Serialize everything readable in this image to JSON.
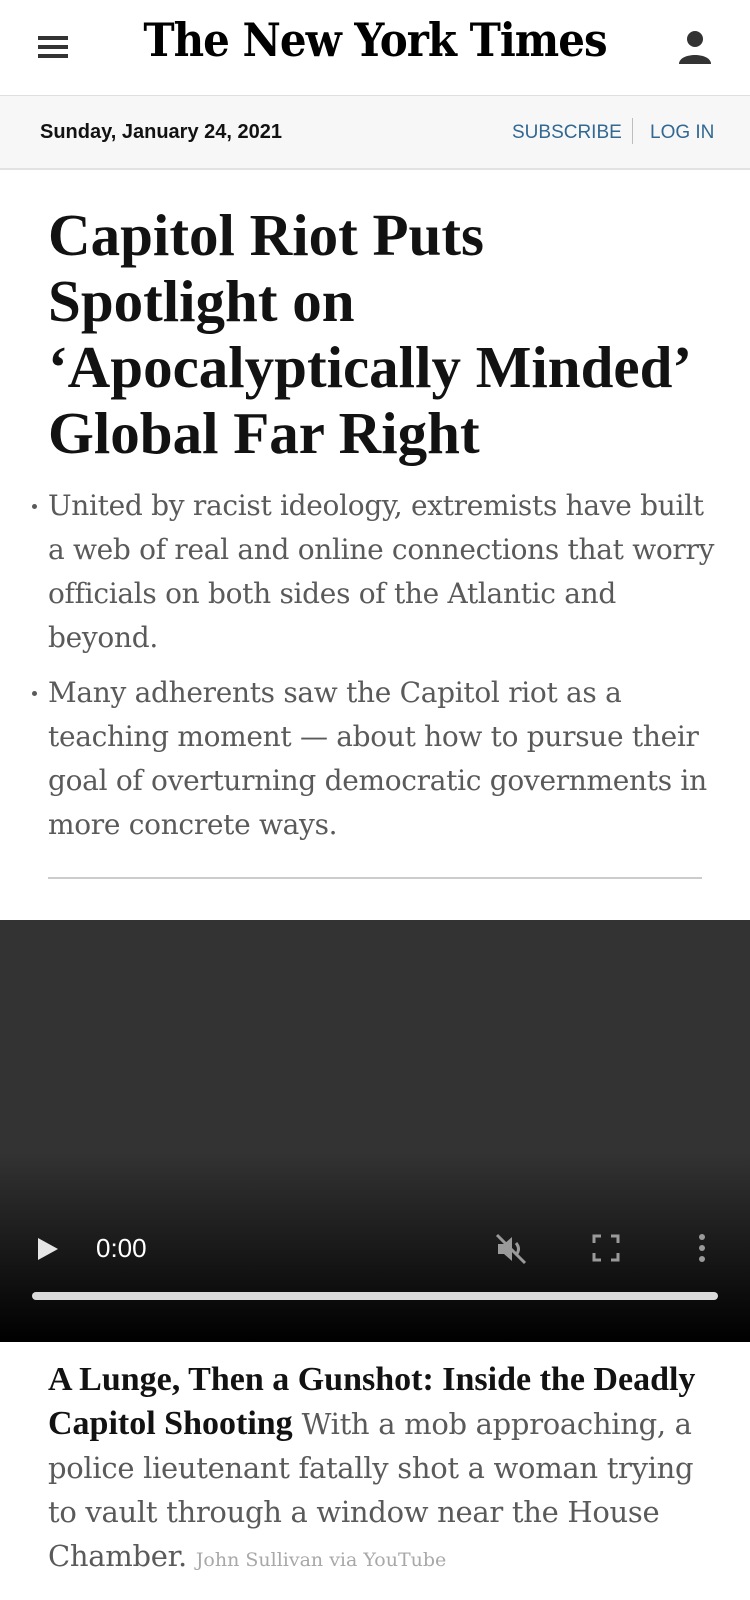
{
  "header": {
    "logo_text": "The New York Times"
  },
  "datebar": {
    "date": "Sunday, January 24, 2021",
    "subscribe_label": "SUBSCRIBE",
    "login_label": "LOG IN"
  },
  "article": {
    "headline": "Capitol Riot Puts Spotlight on ‘Apocalyptically Minded’ Global Far Right",
    "summary": [
      "United by racist ideology, extremists have built a web of real and online connections that worry officials on both sides of the Atlantic and beyond.",
      "Many adherents saw the Capitol riot as a teaching moment — about how to pursue their goal of overturning democratic governments in more concrete ways."
    ]
  },
  "video": {
    "time": "0:00",
    "caption_title": "A Lunge, Then a Gunshot: Inside the Deadly Capitol Shooting",
    "caption_text": "With a mob approaching, a police lieutenant fatally shot a woman trying to vault through a window near the House Chamber.",
    "credit": "John Sullivan via YouTube"
  },
  "icons": {
    "menu": "hamburger-menu-icon",
    "user": "user-account-icon",
    "play": "play-icon",
    "mute": "muted-volume-icon",
    "fullscreen": "fullscreen-icon",
    "more": "more-vertical-icon"
  },
  "colors": {
    "link": "#326891",
    "headline": "#121212",
    "summary": "#5a5a5a",
    "credit": "#a8a8a8"
  }
}
